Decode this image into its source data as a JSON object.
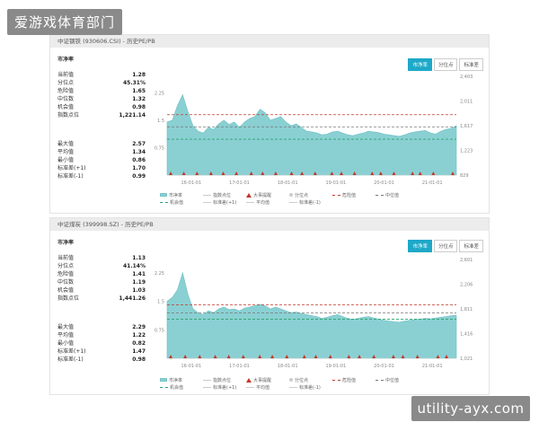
{
  "brand": "爱游戏体育部门",
  "watermark": "utility-ayx.com",
  "colors": {
    "area": "#8ad0d3",
    "danger": "#c0392b",
    "median": "#777777",
    "chance": "#2aa36b",
    "tab_active": "#1ea8c8"
  },
  "panels": [
    {
      "title": "中证钢铁 (930606.CSI) - 历史PE/PB",
      "subtitle": "市净率",
      "tabs": [
        "市净率",
        "分位点",
        "标准差"
      ],
      "active_tab": 0,
      "stats_top": [
        {
          "label": "当前值",
          "value": "1.28"
        },
        {
          "label": "分位点",
          "value": "45.31%"
        },
        {
          "label": "危险值",
          "value": "1.65"
        },
        {
          "label": "中位数",
          "value": "1.32"
        },
        {
          "label": "机会值",
          "value": "0.98"
        },
        {
          "label": "指数点位",
          "value": "1,221.14"
        }
      ],
      "stats_bottom": [
        {
          "label": "最大值",
          "value": "2.57"
        },
        {
          "label": "平均值",
          "value": "1.34"
        },
        {
          "label": "最小值",
          "value": "0.86"
        },
        {
          "label": "标准差(+1)",
          "value": "1.70"
        },
        {
          "label": "标准差(-1)",
          "value": "0.99"
        }
      ],
      "legend": [
        "市净率",
        "指数点位",
        "大事提醒",
        "分位点",
        "危险值",
        "中位值",
        "机会值",
        "标准差(+1)",
        "平均值",
        "标准差(-1)"
      ]
    },
    {
      "title": "中证煤炭 (399998.SZ) - 历史PE/PB",
      "subtitle": "市净率",
      "tabs": [
        "市净率",
        "分位点",
        "标准差"
      ],
      "active_tab": 0,
      "stats_top": [
        {
          "label": "当前值",
          "value": "1.13"
        },
        {
          "label": "分位点",
          "value": "41.14%"
        },
        {
          "label": "危险值",
          "value": "1.41"
        },
        {
          "label": "中位数",
          "value": "1.19"
        },
        {
          "label": "机会值",
          "value": "1.03"
        },
        {
          "label": "指数点位",
          "value": "1,441.26"
        }
      ],
      "stats_bottom": [
        {
          "label": "最大值",
          "value": "2.29"
        },
        {
          "label": "平均值",
          "value": "1.22"
        },
        {
          "label": "最小值",
          "value": "0.82"
        },
        {
          "label": "标准差(+1)",
          "value": "1.47"
        },
        {
          "label": "标准差(-1)",
          "value": "0.98"
        }
      ],
      "legend": [
        "市净率",
        "指数点位",
        "大事提醒",
        "分位点",
        "危险值",
        "中位值",
        "机会值",
        "标准差(+1)",
        "平均值",
        "标准差(-1)"
      ]
    }
  ],
  "chart_data": [
    {
      "type": "area",
      "series": [
        {
          "name": "市净率",
          "values": [
            1.45,
            1.5,
            1.9,
            2.2,
            1.75,
            1.35,
            1.2,
            1.15,
            1.3,
            1.25,
            1.4,
            1.5,
            1.38,
            1.45,
            1.3,
            1.45,
            1.55,
            1.6,
            1.8,
            1.7,
            1.5,
            1.55,
            1.6,
            1.45,
            1.35,
            1.4,
            1.3,
            1.2,
            1.18,
            1.15,
            1.1,
            1.12,
            1.18,
            1.2,
            1.15,
            1.1,
            1.08,
            1.12,
            1.15,
            1.2,
            1.18,
            1.16,
            1.12,
            1.1,
            1.08,
            1.06,
            1.1,
            1.15,
            1.18,
            1.2,
            1.22,
            1.15,
            1.12,
            1.2,
            1.25,
            1.28,
            1.35
          ]
        }
      ],
      "x_ticks": [
        "16-01-01",
        "17-01-01",
        "18-01-01",
        "19-01-01",
        "20-01-01",
        "21-01-01"
      ],
      "y_left_ticks": [
        "2.25",
        "1.5",
        "0.75"
      ],
      "y_right_ticks": [
        "2,403",
        "2,011",
        "1,617",
        "1,223",
        "829"
      ],
      "ylim": [
        0,
        2.7
      ],
      "lines": {
        "danger": 1.65,
        "median": 1.32,
        "chance": 0.98
      },
      "event_markers": 22
    },
    {
      "type": "area",
      "series": [
        {
          "name": "市净率",
          "values": [
            1.5,
            1.6,
            1.8,
            2.25,
            1.7,
            1.3,
            1.2,
            1.15,
            1.25,
            1.2,
            1.3,
            1.35,
            1.28,
            1.3,
            1.25,
            1.32,
            1.35,
            1.38,
            1.42,
            1.38,
            1.3,
            1.35,
            1.3,
            1.25,
            1.2,
            1.22,
            1.18,
            1.15,
            1.12,
            1.1,
            1.05,
            1.08,
            1.12,
            1.15,
            1.1,
            1.05,
            1.02,
            1.05,
            1.08,
            1.1,
            1.06,
            1.03,
            1.0,
            0.98,
            0.96,
            0.95,
            0.98,
            1.0,
            1.02,
            1.03,
            1.05,
            1.04,
            1.06,
            1.08,
            1.1,
            1.12,
            1.13
          ]
        }
      ],
      "x_ticks": [
        "16-01-01",
        "17-01-01",
        "18-01-01",
        "19-01-01",
        "20-01-01",
        "21-01-01"
      ],
      "y_left_ticks": [
        "2.25",
        "1.5",
        "0.75"
      ],
      "y_right_ticks": [
        "2,601",
        "2,206",
        "1,811",
        "1,416",
        "1,021"
      ],
      "ylim": [
        0,
        2.6
      ],
      "lines": {
        "danger": 1.41,
        "median": 1.19,
        "chance": 1.03
      },
      "event_markers": 20
    }
  ]
}
